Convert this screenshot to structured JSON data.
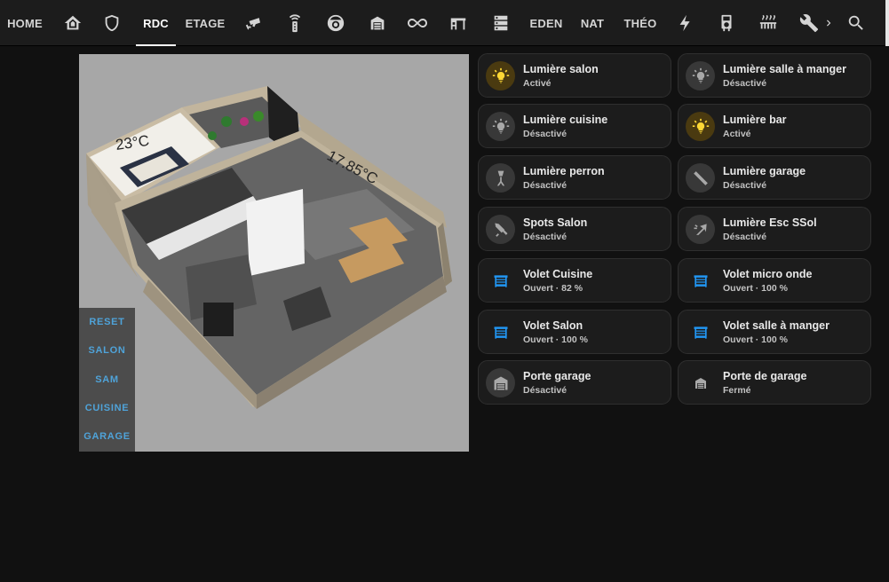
{
  "nav": {
    "tabs": [
      {
        "label": "HOME"
      },
      {
        "icon": "home-shield-icon"
      },
      {
        "icon": "shield-icon"
      },
      {
        "label": "RDC"
      },
      {
        "label": "ETAGE"
      },
      {
        "icon": "cctv-icon"
      },
      {
        "icon": "remote-icon"
      },
      {
        "icon": "robot-vacuum-icon"
      },
      {
        "icon": "warehouse-icon"
      },
      {
        "icon": "infinity-icon"
      },
      {
        "icon": "desk-icon"
      },
      {
        "icon": "server-icon"
      },
      {
        "label": "EDEN"
      },
      {
        "label": "NAT"
      },
      {
        "label": "THÉO"
      },
      {
        "icon": "lightning-icon"
      },
      {
        "icon": "water-heater-icon"
      },
      {
        "icon": "radiator-icon"
      },
      {
        "icon": "wrench-icon"
      },
      {
        "icon": "chevron-right-icon"
      },
      {
        "icon": "search-icon"
      }
    ],
    "active_tab": "RDC"
  },
  "floorplan": {
    "temperatures": [
      "23°C",
      "17.85°C"
    ],
    "zone_buttons": [
      "RESET",
      "SALON",
      "SAM",
      "CUISINE",
      "GARAGE"
    ]
  },
  "cards": [
    {
      "name": "Lumière salon",
      "state": "Activé",
      "icon": "lightbulb-icon",
      "on": true
    },
    {
      "name": "Lumière salle à manger",
      "state": "Désactivé",
      "icon": "lightbulb-icon",
      "on": false
    },
    {
      "name": "Lumière cuisine",
      "state": "Désactivé",
      "icon": "lightbulb-icon",
      "on": false
    },
    {
      "name": "Lumière bar",
      "state": "Activé",
      "icon": "lightbulb-icon",
      "on": true
    },
    {
      "name": "Lumière perron",
      "state": "Désactivé",
      "icon": "floor-lamp-icon",
      "on": false
    },
    {
      "name": "Lumière garage",
      "state": "Désactivé",
      "icon": "light-tube-icon",
      "on": false
    },
    {
      "name": "Spots Salon",
      "state": "Désactivé",
      "icon": "spotlight-icon",
      "on": false
    },
    {
      "name": "Lumière Esc SSol",
      "state": "Désactivé",
      "icon": "stairs-light-icon",
      "on": false
    },
    {
      "name": "Volet Cuisine",
      "state": "Ouvert · 82 %",
      "icon": "window-shutter-icon",
      "on": false
    },
    {
      "name": "Volet micro onde",
      "state": "Ouvert · 100 %",
      "icon": "window-shutter-icon",
      "on": false
    },
    {
      "name": "Volet Salon",
      "state": "Ouvert · 100 %",
      "icon": "window-shutter-icon",
      "on": false
    },
    {
      "name": "Volet salle à manger",
      "state": "Ouvert · 100 %",
      "icon": "window-shutter-icon",
      "on": false
    },
    {
      "name": "Porte garage",
      "state": "Désactivé",
      "icon": "garage-icon",
      "on": false
    },
    {
      "name": "Porte de garage",
      "state": "Fermé",
      "icon": "garage-icon",
      "on": false
    }
  ],
  "colors": {
    "background": "#111111",
    "header": "#1c1c1c",
    "card": "#1c1c1c",
    "light_on": "#fdd835",
    "blind_blue": "#2196f3",
    "zone_text": "#4fa3d9"
  }
}
